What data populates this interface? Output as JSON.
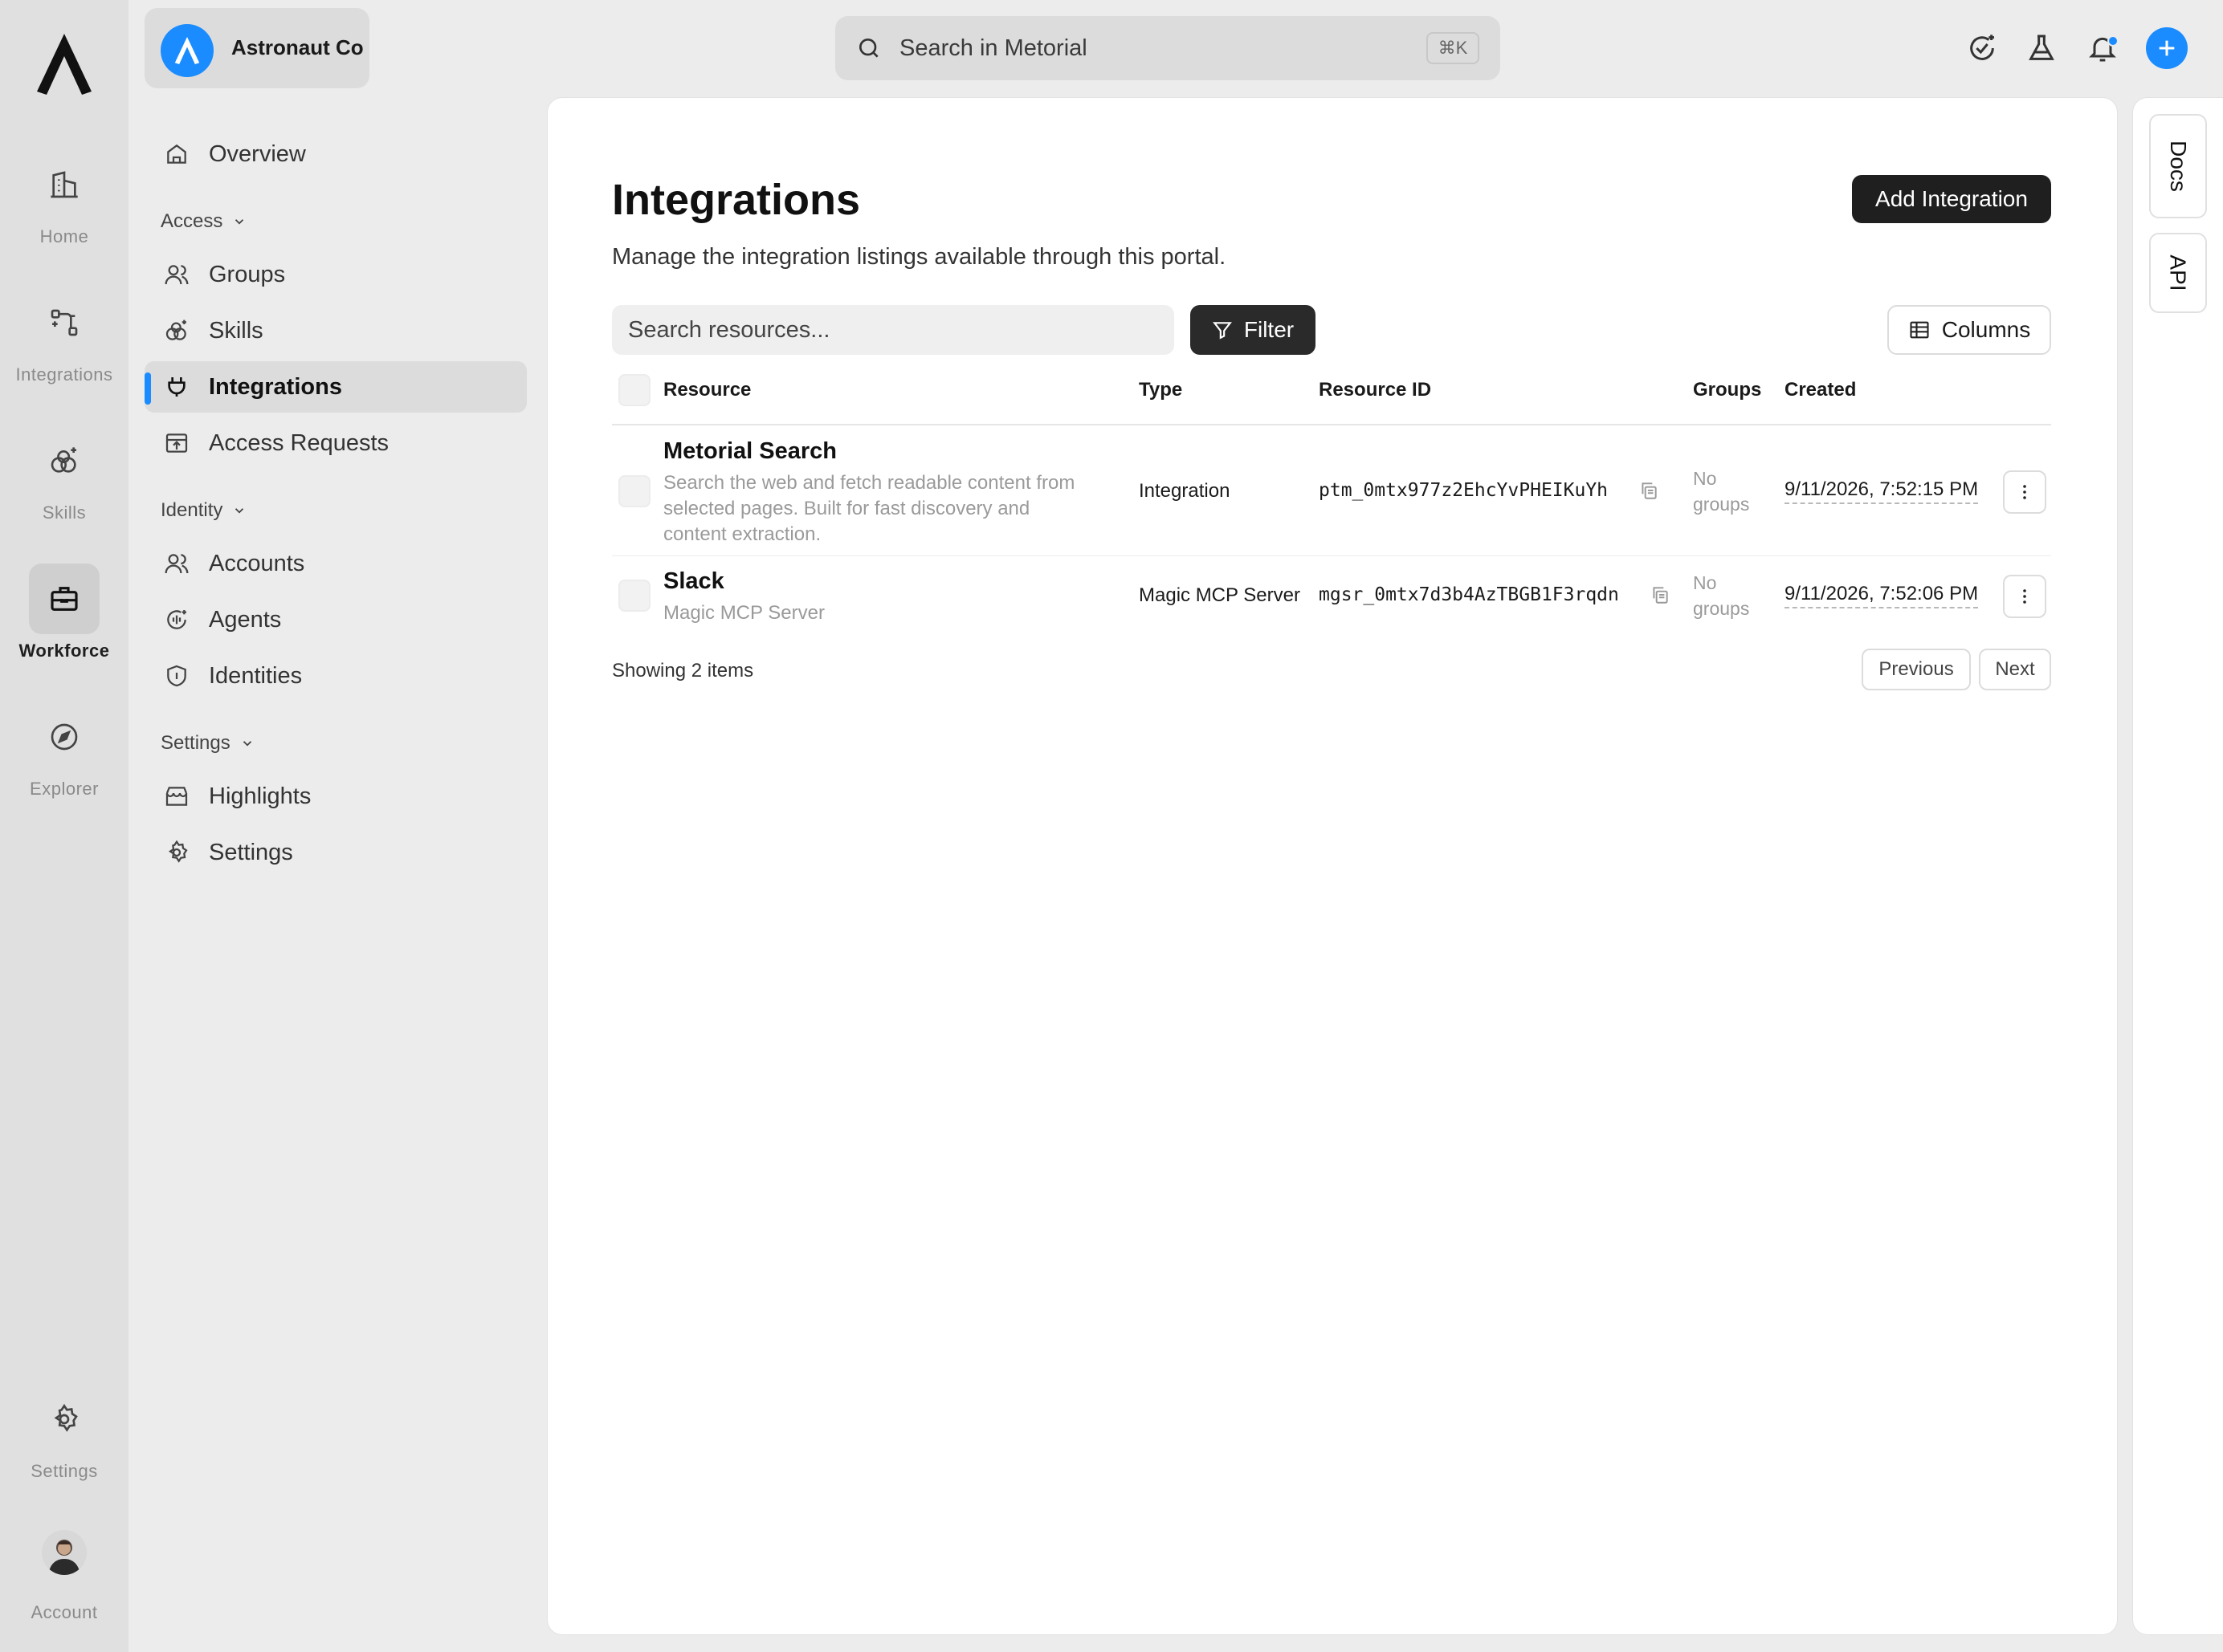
{
  "org": {
    "name": "Astronaut Co"
  },
  "rail": {
    "items": [
      {
        "label": "Home",
        "icon": "building-icon"
      },
      {
        "label": "Integrations",
        "icon": "integrations-icon"
      },
      {
        "label": "Skills",
        "icon": "skills-icon"
      },
      {
        "label": "Workforce",
        "icon": "briefcase-icon",
        "active": true
      },
      {
        "label": "Explorer",
        "icon": "compass-icon"
      },
      {
        "label": "Settings",
        "icon": "gear-icon"
      },
      {
        "label": "Account",
        "icon": "avatar"
      }
    ]
  },
  "sidebar": {
    "overview": "Overview",
    "sections": [
      {
        "label": "Access",
        "items": [
          "Groups",
          "Skills",
          "Integrations",
          "Access Requests"
        ]
      },
      {
        "label": "Identity",
        "items": [
          "Accounts",
          "Agents",
          "Identities"
        ]
      },
      {
        "label": "Settings",
        "items": [
          "Highlights",
          "Settings"
        ]
      }
    ],
    "active_item": "Integrations"
  },
  "topbar": {
    "search_label": "Search in Metorial",
    "shortcut": "⌘K"
  },
  "page": {
    "title": "Integrations",
    "subtitle": "Manage the integration listings available through this portal.",
    "add_button": "Add Integration",
    "search_placeholder": "Search resources...",
    "filter_label": "Filter",
    "columns_label": "Columns"
  },
  "table": {
    "headers": {
      "resource": "Resource",
      "type": "Type",
      "resource_id": "Resource ID",
      "groups": "Groups",
      "created": "Created"
    },
    "rows": [
      {
        "title": "Metorial Search",
        "desc1": "Search the web and fetch readable content from",
        "desc2": "selected pages. Built for fast discovery and",
        "desc3": "content extraction.",
        "type": "Integration",
        "resource_id": "ptm_0mtx977z2EhcYvPHEIKuYh",
        "groups1": "No",
        "groups2": "groups",
        "created": "9/11/2026, 7:52:15 PM"
      },
      {
        "title": "Slack",
        "desc1": "Magic MCP Server",
        "type": "Magic MCP Server",
        "resource_id": "mgsr_0mtx7d3b4AzTBGB1F3rqdn",
        "groups1": "No",
        "groups2": "groups",
        "created": "9/11/2026, 7:52:06 PM"
      }
    ],
    "showing": "Showing 2 items",
    "previous": "Previous",
    "next": "Next"
  },
  "dock": {
    "docs": "Docs",
    "api": "API"
  },
  "colors": {
    "accent": "#1a8cff",
    "dark_button": "#1f1f1f"
  }
}
